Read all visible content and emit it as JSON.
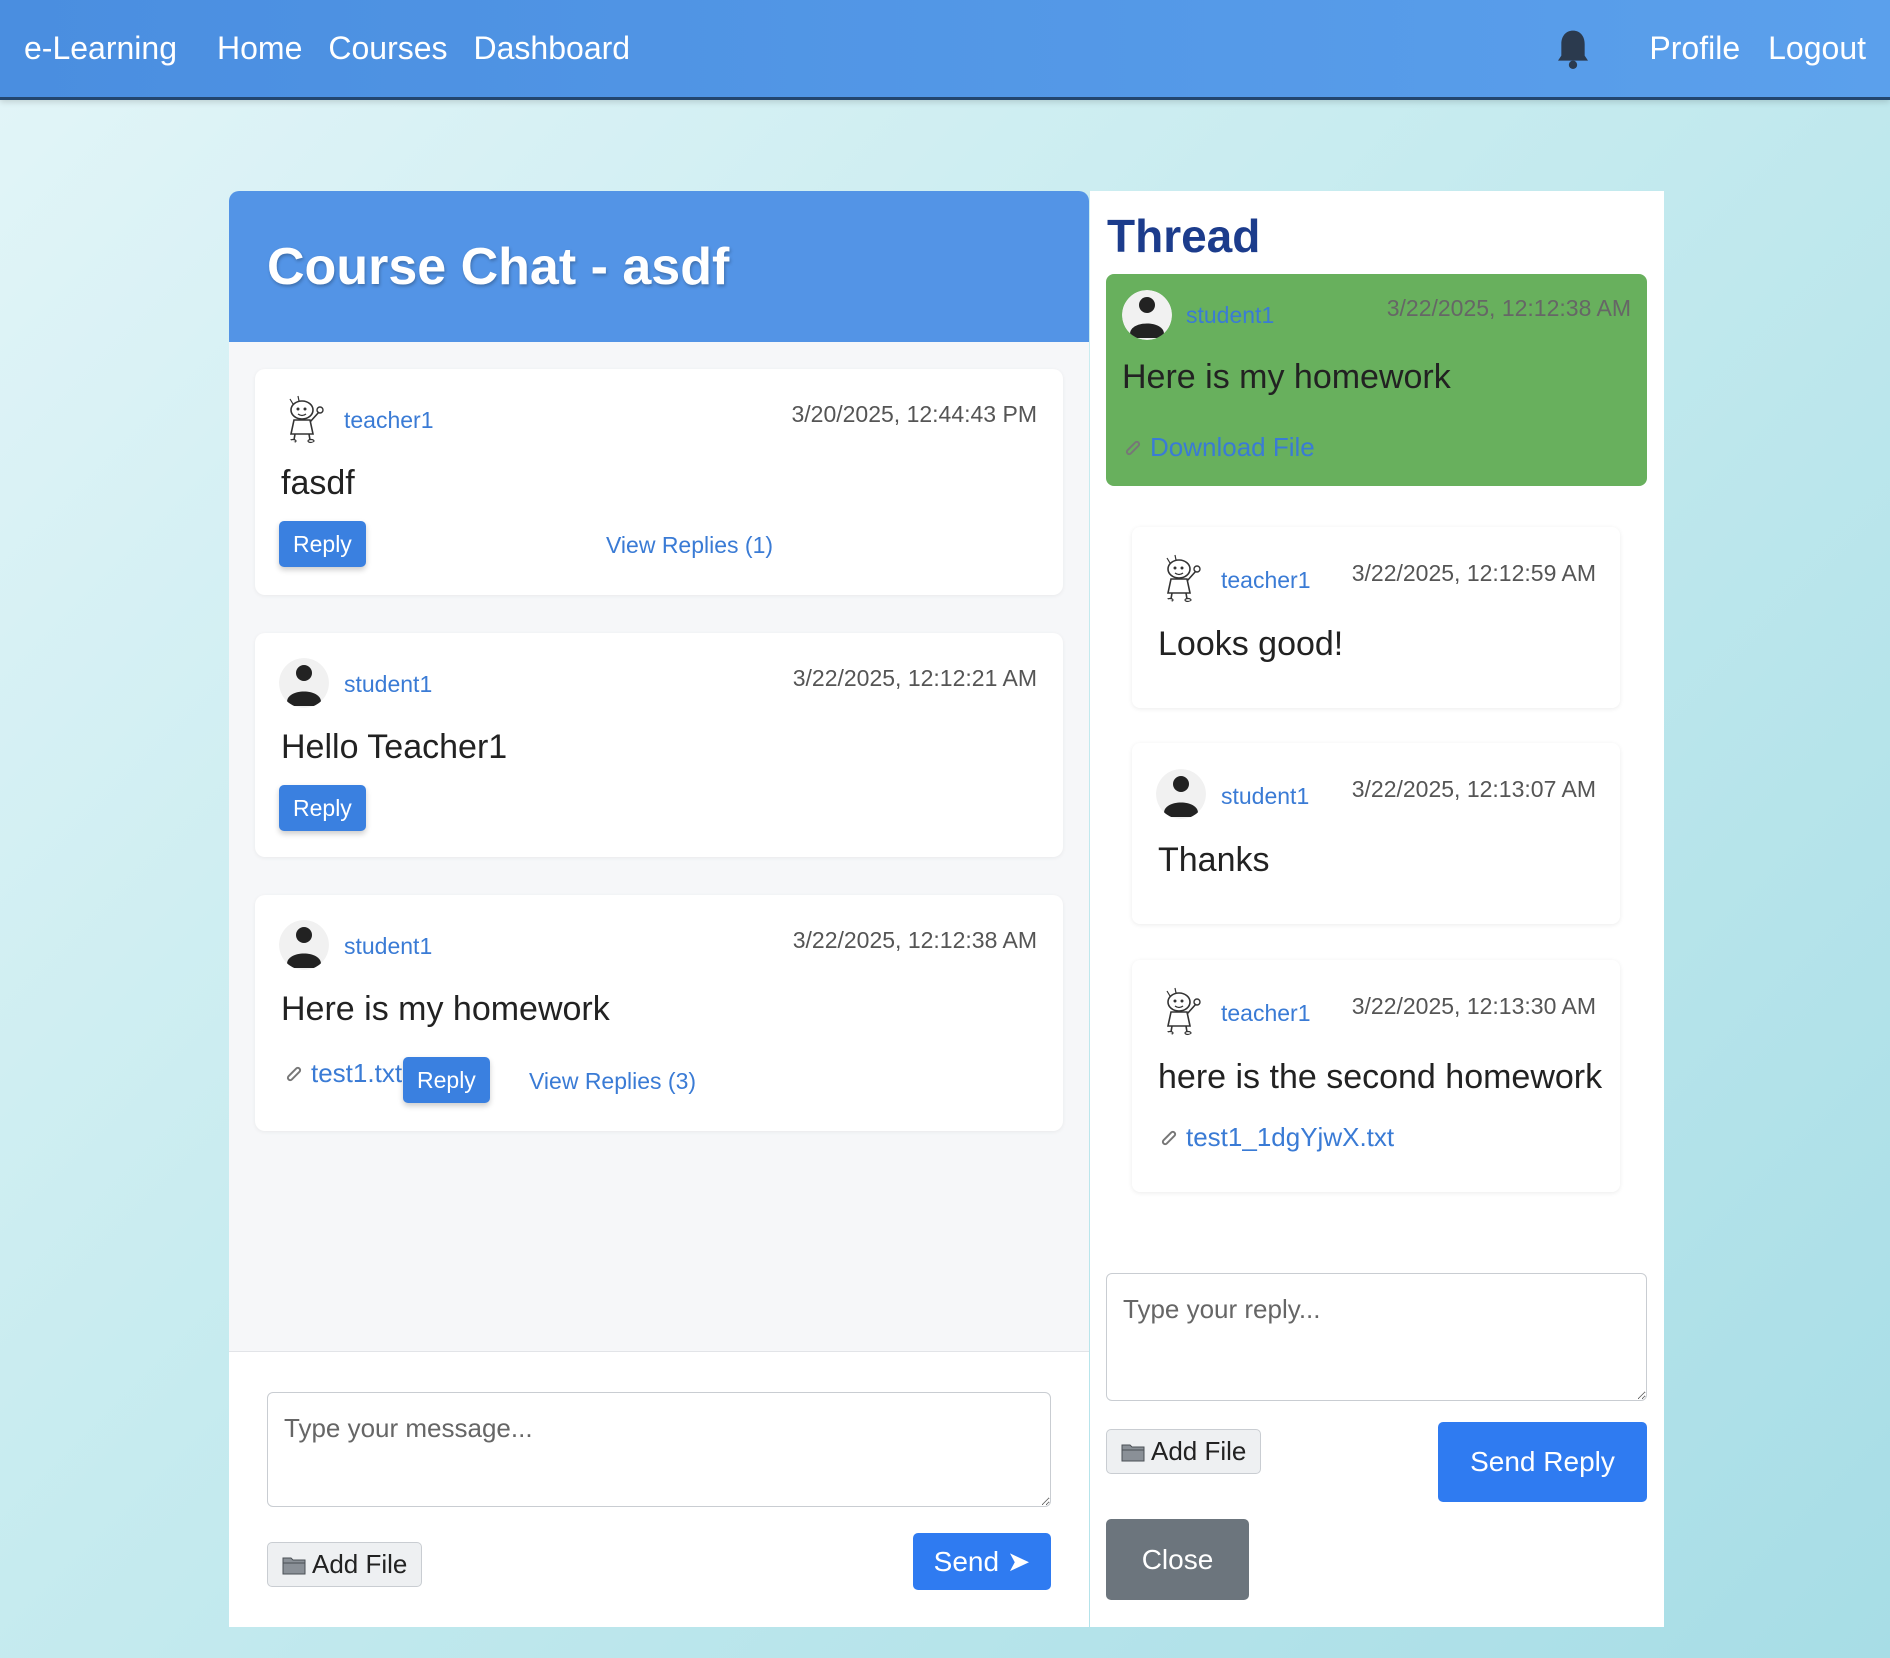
{
  "nav": {
    "brand": "e-Learning",
    "links": [
      "Home",
      "Courses",
      "Dashboard"
    ],
    "right": [
      "Profile",
      "Logout"
    ],
    "bell_icon": "bell-icon"
  },
  "chat": {
    "title": "Course Chat - asdf",
    "messages": [
      {
        "user": "teacher1",
        "time": "3/20/2025, 12:44:43 PM",
        "text": "fasdf",
        "reply_label": "Reply",
        "replies_label": "View Replies (1)",
        "avatar": "cartoon-avatar-icon"
      },
      {
        "user": "student1",
        "time": "3/22/2025, 12:12:21 AM",
        "text": "Hello Teacher1",
        "reply_label": "Reply",
        "avatar": "user-silhouette-icon"
      },
      {
        "user": "student1",
        "time": "3/22/2025, 12:12:38 AM",
        "text": "Here is my homework",
        "attachment": "test1.txt",
        "reply_label": "Reply",
        "replies_label": "View Replies (3)",
        "avatar": "user-silhouette-icon"
      }
    ],
    "input_placeholder": "Type your message...",
    "add_file_label": "Add File",
    "send_label": "Send ➤"
  },
  "thread": {
    "title": "Thread",
    "parent": {
      "user": "student1",
      "time": "3/22/2025, 12:12:38 AM",
      "text": "Here is my homework",
      "download_label": "Download File"
    },
    "replies": [
      {
        "user": "teacher1",
        "time": "3/22/2025, 12:12:59 AM",
        "text": "Looks good!"
      },
      {
        "user": "student1",
        "time": "3/22/2025, 12:13:07 AM",
        "text": "Thanks"
      },
      {
        "user": "teacher1",
        "time": "3/22/2025, 12:13:30 AM",
        "text": "here is the second homework",
        "attachment": "test1_1dgYjwX.txt"
      }
    ],
    "reply_placeholder": "Type your reply...",
    "add_file_label": "Add File",
    "send_reply_label": "Send Reply",
    "close_label": "Close"
  },
  "colors": {
    "navbar": "#4a8ee0",
    "chat_header": "#5394e6",
    "primary_button": "#2f7bf1",
    "parent_highlight": "#68b05d",
    "close_button": "#6c757d"
  }
}
